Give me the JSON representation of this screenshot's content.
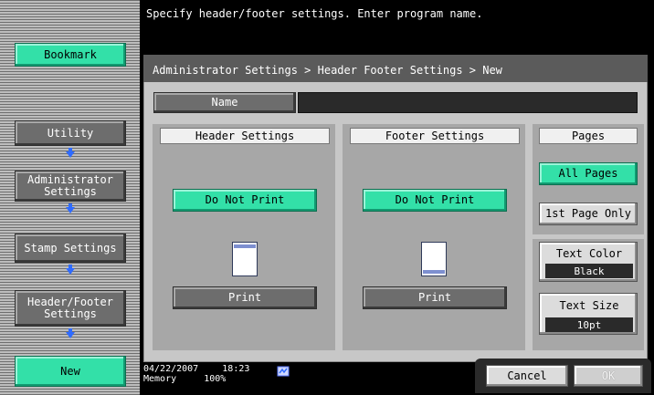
{
  "header": {
    "message": "Specify header/footer settings. Enter program name."
  },
  "sidebar": {
    "bookmark": "Bookmark",
    "steps": [
      "Utility",
      "Administrator Settings",
      "Stamp Settings",
      "Header/Footer Settings",
      "New"
    ]
  },
  "breadcrumb": "Administrator Settings > Header Footer Settings > New",
  "name": {
    "label": "Name",
    "value": ""
  },
  "header_settings": {
    "title": "Header Settings",
    "do_not_print": "Do Not Print",
    "print": "Print"
  },
  "footer_settings": {
    "title": "Footer Settings",
    "do_not_print": "Do Not Print",
    "print": "Print"
  },
  "pages": {
    "title": "Pages",
    "all_pages": "All Pages",
    "first_page_only": "1st Page Only"
  },
  "text_color": {
    "label": "Text Color",
    "value": "Black"
  },
  "text_size": {
    "label": "Text Size",
    "value": "10pt"
  },
  "status": {
    "date": "04/22/2007",
    "time": "18:23",
    "memory_label": "Memory",
    "memory_value": "100%"
  },
  "footer_buttons": {
    "cancel": "Cancel",
    "ok": "OK"
  },
  "colors": {
    "accent_green": "#33e0a8",
    "panel_gray": "#a7a7a7",
    "arrow_blue": "#2f6bff"
  }
}
